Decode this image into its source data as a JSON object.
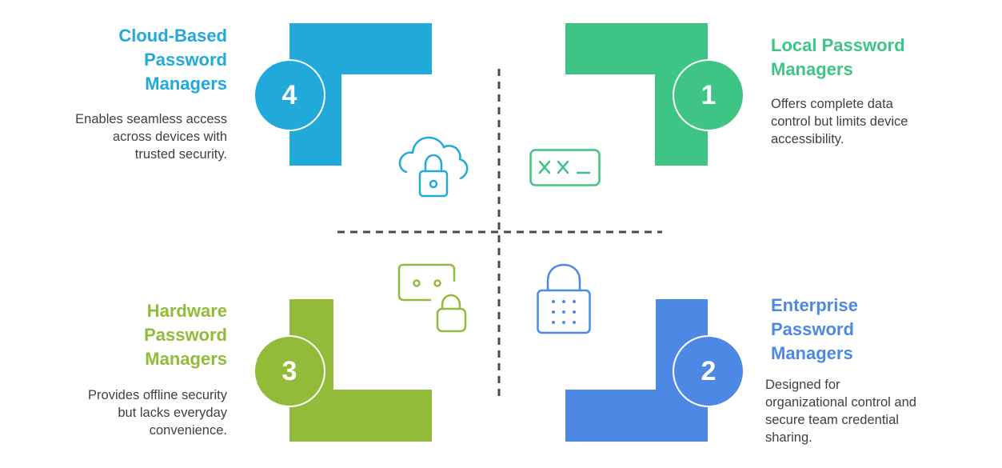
{
  "colors": {
    "cloud": "#21a9da",
    "local": "#3ec586",
    "hardware": "#92bb3a",
    "enterprise": "#4d89e4",
    "divider": "#4a4a4a",
    "text": "#3c4148"
  },
  "quadrants": {
    "cloud": {
      "number": "4",
      "title_lines": [
        "Cloud-Based",
        "Password",
        "Managers"
      ],
      "description_lines": [
        "Enables seamless access",
        "across devices with",
        "trusted security."
      ],
      "icon": "cloud-lock-icon"
    },
    "local": {
      "number": "1",
      "title_lines": [
        "Local Password",
        "Managers"
      ],
      "description_lines": [
        "Offers complete data",
        "control but limits device",
        "accessibility."
      ],
      "icon": "password-field-icon",
      "icon_text": "XX_"
    },
    "hardware": {
      "number": "3",
      "title_lines": [
        "Hardware",
        "Password",
        "Managers"
      ],
      "description_lines": [
        "Provides offline security",
        "but lacks everyday",
        "convenience."
      ],
      "icon": "device-lock-icon"
    },
    "enterprise": {
      "number": "2",
      "title_lines": [
        "Enterprise",
        "Password",
        "Managers"
      ],
      "description_lines": [
        "Designed for",
        "organizational control and",
        "secure team credential",
        "sharing."
      ],
      "icon": "keypad-lock-icon"
    }
  }
}
